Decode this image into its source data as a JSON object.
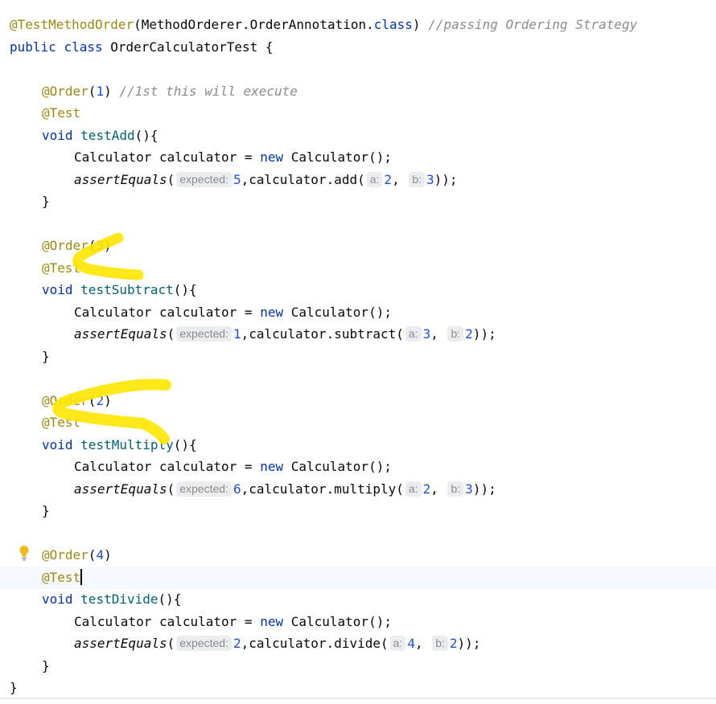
{
  "code": {
    "l1_annotation": "@TestMethodOrder",
    "l1_open": "(MethodOrderer.OrderAnnotation.",
    "l1_class_kw": "class",
    "l1_close": ")",
    "l1_comment": "//passing Ordering Strategy",
    "l2_public": "public",
    "l2_class": "class",
    "l2_rest": "OrderCalculatorTest {",
    "order_annotation": "@Order",
    "test_annotation": "@Test",
    "void_kw": "void",
    "new_kw": "new",
    "calc_decl_a": "Calculator calculator = ",
    "calc_decl_b": "Calculator();",
    "assert_fn": "assertEquals",
    "hint_expected": "expected:",
    "hint_a": "a:",
    "hint_b": "b:",
    "close_brace": "}",
    "methods": [
      {
        "order": "1",
        "order_comment": "//1st this will execute",
        "name": "testAdd",
        "expected": "5",
        "call": "calculator.add(",
        "a": "2",
        "b": "3"
      },
      {
        "order": "3",
        "order_comment": "",
        "name": "testSubtract",
        "expected": "1",
        "call": "calculator.subtract(",
        "a": "3",
        "b": "2"
      },
      {
        "order": "2",
        "order_comment": "",
        "name": "testMultiply",
        "expected": "6",
        "call": "calculator.multiply(",
        "a": "2",
        "b": "3"
      },
      {
        "order": "4",
        "order_comment": "",
        "name": "testDivide",
        "expected": "2",
        "call": "calculator.divide(",
        "a": "4",
        "b": "2"
      }
    ]
  },
  "icons": {
    "intention_bulb": "lightbulb-icon"
  },
  "colors": {
    "annotation": "#9e880d",
    "keyword": "#0033b3",
    "number": "#1750eb",
    "comment": "#8c8c8c",
    "method_name": "#00627a",
    "highlighter": "#ffe600",
    "caret_line": "#f5f8fe"
  }
}
